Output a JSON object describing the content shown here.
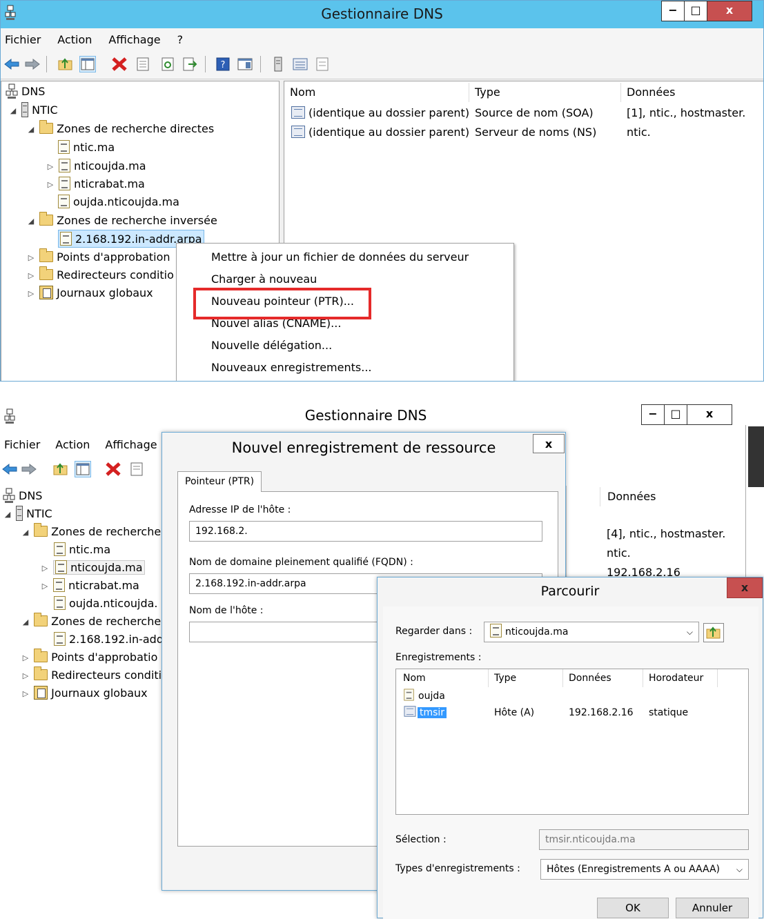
{
  "top_window": {
    "title": "Gestionnaire DNS",
    "menu": [
      "Fichier",
      "Action",
      "Affichage",
      "?"
    ],
    "tree": {
      "root": "DNS",
      "server": "NTIC",
      "forward_zones": "Zones de recherche directes",
      "zone_items": [
        "ntic.ma",
        "nticoujda.ma",
        "nticrabat.ma",
        "oujda.nticoujda.ma"
      ],
      "reverse_zones": "Zones de recherche inversée",
      "reverse_item": "2.168.192.in-addr.arpa",
      "trust_points": "Points d'approbation",
      "forwarders": "Redirecteurs conditio",
      "global_logs": "Journaux globaux"
    },
    "columns": [
      "Nom",
      "Type",
      "Données"
    ],
    "rows": [
      {
        "name": "(identique au dossier parent)",
        "type": "Source de nom (SOA)",
        "data": "[1], ntic., hostmaster."
      },
      {
        "name": "(identique au dossier parent)",
        "type": "Serveur de noms (NS)",
        "data": "ntic."
      }
    ],
    "context_menu": [
      "Mettre à jour un fichier de données du serveur",
      "Charger à nouveau",
      "Nouveau pointeur (PTR)...",
      "Nouvel alias (CNAME)...",
      "Nouvelle délégation...",
      "Nouveaux enregistrements..."
    ],
    "highlight_color": "#e52a2a"
  },
  "bottom_window": {
    "title": "Gestionnaire DNS",
    "menu": [
      "Fichier",
      "Action",
      "Affichage"
    ],
    "tree": {
      "root": "DNS",
      "server": "NTIC",
      "forward_zones": "Zones de recherche",
      "zone_items": [
        "ntic.ma",
        "nticoujda.ma",
        "nticrabat.ma",
        "oujda.nticoujda."
      ],
      "reverse_zones": "Zones de recherche",
      "reverse_item": "2.168.192.in-add",
      "trust_points": "Points d'approbatio",
      "forwarders": "Redirecteurs conditi",
      "global_logs": "Journaux globaux"
    },
    "right_header": "Données",
    "right_values": [
      "[4], ntic., hostmaster.",
      "ntic.",
      "192.168.2.16"
    ]
  },
  "rr_dialog": {
    "title": "Nouvel enregistrement de ressource",
    "tab": "Pointeur (PTR)",
    "ip_label": "Adresse IP de l'hôte :",
    "ip_value": "192.168.2.",
    "fqdn_label": "Nom de domaine pleinement qualifié (FQDN) :",
    "fqdn_value": "2.168.192.in-addr.arpa",
    "host_label": "Nom de l'hôte :",
    "host_value": ""
  },
  "browse_dialog": {
    "title": "Parcourir",
    "look_in_label": "Regarder dans :",
    "look_in_value": "nticoujda.ma",
    "records_label": "Enregistrements :",
    "columns": [
      "Nom",
      "Type",
      "Données",
      "Horodateur"
    ],
    "rows": [
      {
        "name": "oujda",
        "type": "",
        "data": "",
        "timestamp": ""
      },
      {
        "name": "tmsir",
        "type": "Hôte (A)",
        "data": "192.168.2.16",
        "timestamp": "statique"
      }
    ],
    "selection_label": "Sélection :",
    "selection_value": "tmsir.nticoujda.ma",
    "types_label": "Types d'enregistrements :",
    "types_value": "Hôtes (Enregistrements A ou AAAA)",
    "ok_label": "OK",
    "cancel_label": "Annuler"
  },
  "icons": [
    "back-arrow-icon",
    "forward-arrow-icon",
    "up-folder-icon",
    "console-tree-icon",
    "delete-icon",
    "properties-icon",
    "refresh-icon",
    "export-icon",
    "help-icon",
    "view-icon",
    "server-icon",
    "list-icon",
    "records-icon"
  ],
  "colors": {
    "titlebar": "#5bc3ec",
    "close_button": "#c75050",
    "selection": "#cce8ff",
    "selected_record": "#3399ff"
  }
}
